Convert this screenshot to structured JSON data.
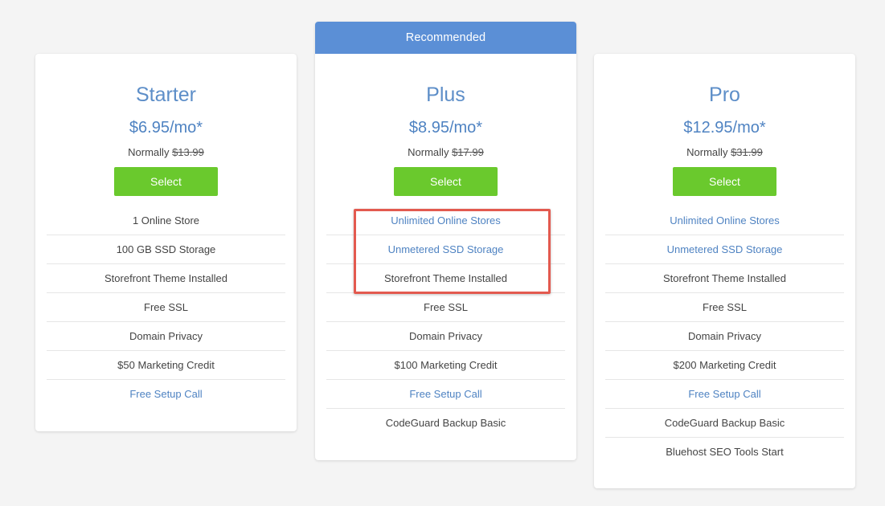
{
  "plans": [
    {
      "name": "Starter",
      "price": "$6.95/mo*",
      "normally_label": "Normally",
      "normally_price": "$13.99",
      "select_label": "Select",
      "features": [
        {
          "text": "1 Online Store",
          "link": false
        },
        {
          "text": "100 GB SSD Storage",
          "link": false
        },
        {
          "text": "Storefront Theme Installed",
          "link": false
        },
        {
          "text": "Free SSL",
          "link": false
        },
        {
          "text": "Domain Privacy",
          "link": false
        },
        {
          "text": "$50 Marketing Credit",
          "link": false
        },
        {
          "text": "Free Setup Call",
          "link": true
        }
      ]
    },
    {
      "name": "Plus",
      "banner": "Recommended",
      "price": "$8.95/mo*",
      "normally_label": "Normally",
      "normally_price": "$17.99",
      "select_label": "Select",
      "features": [
        {
          "text": "Unlimited Online Stores",
          "link": true
        },
        {
          "text": "Unmetered SSD Storage",
          "link": true
        },
        {
          "text": "Storefront Theme Installed",
          "link": false
        },
        {
          "text": "Free SSL",
          "link": false
        },
        {
          "text": "Domain Privacy",
          "link": false
        },
        {
          "text": "$100 Marketing Credit",
          "link": false
        },
        {
          "text": "Free Setup Call",
          "link": true
        },
        {
          "text": "CodeGuard Backup Basic",
          "link": false
        }
      ]
    },
    {
      "name": "Pro",
      "price": "$12.95/mo*",
      "normally_label": "Normally",
      "normally_price": "$31.99",
      "select_label": "Select",
      "features": [
        {
          "text": "Unlimited Online Stores",
          "link": true
        },
        {
          "text": "Unmetered SSD Storage",
          "link": true
        },
        {
          "text": "Storefront Theme Installed",
          "link": false
        },
        {
          "text": "Free SSL",
          "link": false
        },
        {
          "text": "Domain Privacy",
          "link": false
        },
        {
          "text": "$200 Marketing Credit",
          "link": false
        },
        {
          "text": "Free Setup Call",
          "link": true
        },
        {
          "text": "CodeGuard Backup Basic",
          "link": false
        },
        {
          "text": "Bluehost SEO Tools Start",
          "link": false
        }
      ]
    }
  ],
  "colors": {
    "accent_blue": "#5b8fd6",
    "link_blue": "#4f83c2",
    "select_green": "#6ac92d",
    "highlight_red": "#e35a4f"
  }
}
